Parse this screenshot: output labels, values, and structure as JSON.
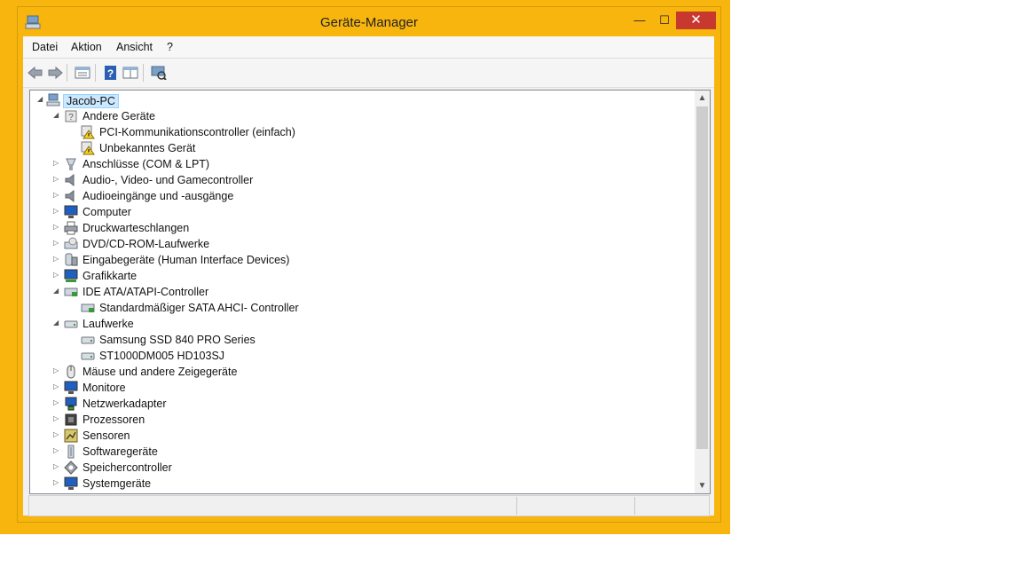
{
  "window": {
    "title": "Geräte-Manager",
    "controls": {
      "minimize": "—",
      "maximize": "☐",
      "close": "✕"
    }
  },
  "menu": {
    "items": [
      "Datei",
      "Aktion",
      "Ansicht",
      "?"
    ]
  },
  "toolbar": {
    "icons": [
      "back-icon",
      "forward-icon",
      "properties-icon",
      "help-icon",
      "view-icon",
      "scan-hardware-icon"
    ]
  },
  "tree": {
    "nodes": [
      {
        "label": "Jacob-PC",
        "level": 0,
        "expander": "expanded",
        "icon": "computer-icon",
        "selected": true
      },
      {
        "label": "Andere Geräte",
        "level": 1,
        "expander": "expanded",
        "icon": "unknown-device-icon"
      },
      {
        "label": "PCI-Kommunikationscontroller (einfach)",
        "level": 2,
        "expander": "none",
        "icon": "warning-device-icon"
      },
      {
        "label": "Unbekanntes Gerät",
        "level": 2,
        "expander": "none",
        "icon": "warning-device-icon"
      },
      {
        "label": "Anschlüsse (COM & LPT)",
        "level": 1,
        "expander": "collapsed",
        "icon": "port-icon"
      },
      {
        "label": "Audio-, Video- und Gamecontroller",
        "level": 1,
        "expander": "collapsed",
        "icon": "speaker-icon"
      },
      {
        "label": "Audioeingänge und -ausgänge",
        "level": 1,
        "expander": "collapsed",
        "icon": "speaker-icon"
      },
      {
        "label": "Computer",
        "level": 1,
        "expander": "collapsed",
        "icon": "monitor-icon"
      },
      {
        "label": "Druckwarteschlangen",
        "level": 1,
        "expander": "collapsed",
        "icon": "printer-icon"
      },
      {
        "label": "DVD/CD-ROM-Laufwerke",
        "level": 1,
        "expander": "collapsed",
        "icon": "dvd-drive-icon"
      },
      {
        "label": "Eingabegeräte (Human Interface Devices)",
        "level": 1,
        "expander": "collapsed",
        "icon": "hid-icon"
      },
      {
        "label": "Grafikkarte",
        "level": 1,
        "expander": "collapsed",
        "icon": "display-adapter-icon"
      },
      {
        "label": "IDE ATA/ATAPI-Controller",
        "level": 1,
        "expander": "expanded",
        "icon": "ide-controller-icon"
      },
      {
        "label": "Standardmäßiger SATA AHCI- Controller",
        "level": 2,
        "expander": "none",
        "icon": "ide-controller-icon"
      },
      {
        "label": "Laufwerke",
        "level": 1,
        "expander": "expanded",
        "icon": "drive-icon"
      },
      {
        "label": "Samsung SSD 840 PRO Series",
        "level": 2,
        "expander": "none",
        "icon": "drive-icon"
      },
      {
        "label": "ST1000DM005 HD103SJ",
        "level": 2,
        "expander": "none",
        "icon": "drive-icon"
      },
      {
        "label": "Mäuse und andere Zeigegeräte",
        "level": 1,
        "expander": "collapsed",
        "icon": "mouse-icon"
      },
      {
        "label": "Monitore",
        "level": 1,
        "expander": "collapsed",
        "icon": "monitor-icon"
      },
      {
        "label": "Netzwerkadapter",
        "level": 1,
        "expander": "collapsed",
        "icon": "network-adapter-icon"
      },
      {
        "label": "Prozessoren",
        "level": 1,
        "expander": "collapsed",
        "icon": "processor-icon"
      },
      {
        "label": "Sensoren",
        "level": 1,
        "expander": "collapsed",
        "icon": "sensor-icon"
      },
      {
        "label": "Softwaregeräte",
        "level": 1,
        "expander": "collapsed",
        "icon": "software-device-icon"
      },
      {
        "label": "Speichercontroller",
        "level": 1,
        "expander": "collapsed",
        "icon": "storage-controller-icon"
      },
      {
        "label": "Systemgeräte",
        "level": 1,
        "expander": "collapsed",
        "icon": "monitor-icon"
      }
    ]
  },
  "colors": {
    "desktop": "#f7b50e",
    "close_button": "#c7392e",
    "selection": "#cce8ff"
  }
}
